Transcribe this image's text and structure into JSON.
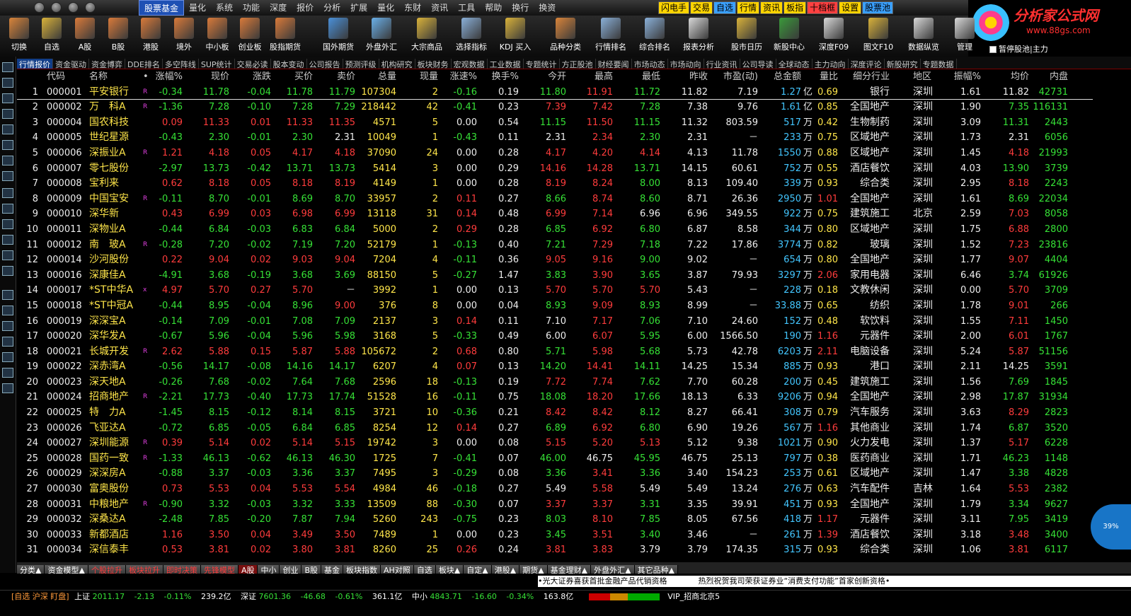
{
  "menu": [
    "股票基金",
    "量化",
    "系统",
    "功能",
    "深度",
    "报价",
    "分析",
    "扩展",
    "量化",
    "东财",
    "资讯",
    "工具",
    "帮助",
    "换行",
    "换资"
  ],
  "quick": [
    "闪电手",
    "交易",
    "自选",
    "行情",
    "资讯",
    "板指",
    "十档框",
    "设置",
    "股票池"
  ],
  "quick_colors": [
    "#ffd400",
    "#ffd400",
    "#3aa0ff",
    "#ffd400",
    "#ffd400",
    "#ffd400",
    "#ff4040",
    "#ffd400",
    "#3aa0ff"
  ],
  "logo": {
    "title": "分析家公式网",
    "url": "www.88gs.com"
  },
  "toolbar": [
    "切换",
    "自选",
    "A股",
    "B股",
    "港股",
    "境外",
    "中小板",
    "创业板",
    "股指期货",
    "国外期货",
    "外盘外汇",
    "大宗商品",
    "选择指标",
    "KDJ 买入",
    "品种分类",
    "行情排名",
    "综合排名",
    "报表分析",
    "股市日历",
    "新股中心",
    "深度F09",
    "图文F10",
    "数据纵览",
    "管理"
  ],
  "toolbar_colors": [
    "#d9843a",
    "#d9b23a",
    "#d97a3a",
    "#d97a3a",
    "#d97a3a",
    "#d97a3a",
    "#d97a3a",
    "#d97a3a",
    "#d97a3a",
    "#4a90d9",
    "#6ab0e9",
    "#d9b23a",
    "#8ab0d9",
    "#d9b23a",
    "#d9843a",
    "#8ab0d9",
    "#8ab0d9",
    "#d9d9d9",
    "#d9b23a",
    "#3a9a3a",
    "#d9d9d9",
    "#d9b23a",
    "#d9d9d9",
    "#d9d9d9"
  ],
  "pause_label": "暂停股池|主力",
  "tabs": [
    "行情报价",
    "资金驱动",
    "资金博弈",
    "DDE排名",
    "多空阵线",
    "SUP统计",
    "交易必读",
    "股本变动",
    "公司报告",
    "预测评级",
    "机构研究",
    "板块财务",
    "宏观数据",
    "工业数据",
    "专题统计",
    "方正股池",
    "财经要闻",
    "市场动态",
    "市场动向",
    "行业资讯",
    "公司导读",
    "全球动态",
    "主力动向",
    "深度评论",
    "新股研究",
    "专题数据"
  ],
  "headers": [
    "",
    "代码",
    "名称",
    "•",
    "涨幅%",
    "现价",
    "涨跌",
    "买价",
    "卖价",
    "总量",
    "现量",
    "涨速%",
    "换手%",
    "今开",
    "最高",
    "最低",
    "昨收",
    "市盈(动)",
    "总金额",
    "量比",
    "细分行业",
    "地区",
    "振幅%",
    "均价",
    "内盘"
  ],
  "rows": [
    [
      "1",
      "000001",
      "平安银行",
      "R",
      "-0.34",
      "11.78",
      "-0.04",
      "11.78",
      "11.79",
      "107304",
      "2",
      "-0.16",
      "0.19",
      "11.80",
      "11.91",
      "11.72",
      "11.82",
      "7.19",
      "1.27",
      "亿",
      "0.69",
      "银行",
      "深圳",
      "1.61",
      "11.82",
      "42731"
    ],
    [
      "2",
      "000002",
      "万　科A",
      "R",
      "-1.36",
      "7.28",
      "-0.10",
      "7.28",
      "7.29",
      "218442",
      "42",
      "-0.41",
      "0.23",
      "7.39",
      "7.42",
      "7.28",
      "7.38",
      "9.76",
      "1.61",
      "亿",
      "0.85",
      "全国地产",
      "深圳",
      "1.90",
      "7.35",
      "116131"
    ],
    [
      "3",
      "000004",
      "国农科技",
      "",
      "0.09",
      "11.33",
      "0.01",
      "11.33",
      "11.35",
      "4571",
      "5",
      "0.00",
      "0.54",
      "11.15",
      "11.50",
      "11.15",
      "11.32",
      "803.59",
      "517",
      "万",
      "0.42",
      "生物制药",
      "深圳",
      "3.09",
      "11.31",
      "2443"
    ],
    [
      "4",
      "000005",
      "世纪星源",
      "",
      "-0.43",
      "2.30",
      "-0.01",
      "2.30",
      "2.31",
      "10049",
      "1",
      "-0.43",
      "0.11",
      "2.31",
      "2.34",
      "2.30",
      "2.31",
      "－",
      "233",
      "万",
      "0.75",
      "区域地产",
      "深圳",
      "1.73",
      "2.31",
      "6056"
    ],
    [
      "5",
      "000006",
      "深振业A",
      "R",
      "1.21",
      "4.18",
      "0.05",
      "4.17",
      "4.18",
      "37090",
      "24",
      "0.00",
      "0.28",
      "4.17",
      "4.20",
      "4.14",
      "4.13",
      "11.78",
      "1550",
      "万",
      "0.88",
      "区域地产",
      "深圳",
      "1.45",
      "4.18",
      "21993"
    ],
    [
      "6",
      "000007",
      "零七股份",
      "",
      "-2.97",
      "13.73",
      "-0.42",
      "13.71",
      "13.73",
      "5414",
      "3",
      "0.00",
      "0.29",
      "14.16",
      "14.28",
      "13.71",
      "14.15",
      "60.61",
      "752",
      "万",
      "0.55",
      "酒店餐饮",
      "深圳",
      "4.03",
      "13.90",
      "3739"
    ],
    [
      "7",
      "000008",
      "宝利来",
      "",
      "0.62",
      "8.18",
      "0.05",
      "8.18",
      "8.19",
      "4149",
      "1",
      "0.00",
      "0.28",
      "8.19",
      "8.24",
      "8.00",
      "8.13",
      "109.40",
      "339",
      "万",
      "0.93",
      "综合类",
      "深圳",
      "2.95",
      "8.18",
      "2243"
    ],
    [
      "8",
      "000009",
      "中国宝安",
      "R",
      "-0.11",
      "8.70",
      "-0.01",
      "8.69",
      "8.70",
      "33957",
      "2",
      "0.11",
      "0.27",
      "8.66",
      "8.74",
      "8.60",
      "8.71",
      "26.36",
      "2950",
      "万",
      "1.01",
      "全国地产",
      "深圳",
      "1.61",
      "8.69",
      "22034"
    ],
    [
      "9",
      "000010",
      "深华新",
      "",
      "0.43",
      "6.99",
      "0.03",
      "6.98",
      "6.99",
      "13118",
      "31",
      "0.14",
      "0.48",
      "6.99",
      "7.14",
      "6.96",
      "6.96",
      "349.55",
      "922",
      "万",
      "0.75",
      "建筑施工",
      "北京",
      "2.59",
      "7.03",
      "8058"
    ],
    [
      "10",
      "000011",
      "深物业A",
      "",
      "-0.44",
      "6.84",
      "-0.03",
      "6.83",
      "6.84",
      "5000",
      "2",
      "0.29",
      "0.28",
      "6.85",
      "6.92",
      "6.80",
      "6.87",
      "8.58",
      "344",
      "万",
      "0.80",
      "区域地产",
      "深圳",
      "1.75",
      "6.88",
      "2800"
    ],
    [
      "11",
      "000012",
      "南　玻A",
      "R",
      "-0.28",
      "7.20",
      "-0.02",
      "7.19",
      "7.20",
      "52179",
      "1",
      "-0.13",
      "0.40",
      "7.21",
      "7.29",
      "7.18",
      "7.22",
      "17.86",
      "3774",
      "万",
      "0.82",
      "玻璃",
      "深圳",
      "1.52",
      "7.23",
      "23816"
    ],
    [
      "12",
      "000014",
      "沙河股份",
      "",
      "0.22",
      "9.04",
      "0.02",
      "9.03",
      "9.04",
      "7204",
      "4",
      "-0.11",
      "0.36",
      "9.05",
      "9.16",
      "9.00",
      "9.02",
      "－",
      "654",
      "万",
      "0.80",
      "全国地产",
      "深圳",
      "1.77",
      "9.07",
      "4404"
    ],
    [
      "13",
      "000016",
      "深康佳A",
      "",
      "-4.91",
      "3.68",
      "-0.19",
      "3.68",
      "3.69",
      "88150",
      "5",
      "-0.27",
      "1.47",
      "3.83",
      "3.90",
      "3.65",
      "3.87",
      "79.93",
      "3297",
      "万",
      "2.06",
      "家用电器",
      "深圳",
      "6.46",
      "3.74",
      "61926"
    ],
    [
      "14",
      "000017",
      "*ST中华A",
      "x",
      "4.97",
      "5.70",
      "0.27",
      "5.70",
      "－",
      "3992",
      "1",
      "0.00",
      "0.13",
      "5.70",
      "5.70",
      "5.70",
      "5.43",
      "－",
      "228",
      "万",
      "0.18",
      "文教休闲",
      "深圳",
      "0.00",
      "5.70",
      "3709"
    ],
    [
      "15",
      "000018",
      "*ST中冠A",
      "",
      "-0.44",
      "8.95",
      "-0.04",
      "8.96",
      "9.00",
      "376",
      "8",
      "0.00",
      "0.04",
      "8.93",
      "9.09",
      "8.93",
      "8.99",
      "－",
      "33.88",
      "万",
      "0.65",
      "纺织",
      "深圳",
      "1.78",
      "9.01",
      "266"
    ],
    [
      "16",
      "000019",
      "深深宝A",
      "",
      "-0.14",
      "7.09",
      "-0.01",
      "7.08",
      "7.09",
      "2137",
      "3",
      "0.14",
      "0.11",
      "7.10",
      "7.17",
      "7.06",
      "7.10",
      "24.60",
      "152",
      "万",
      "0.48",
      "软饮料",
      "深圳",
      "1.55",
      "7.11",
      "1450"
    ],
    [
      "17",
      "000020",
      "深华发A",
      "",
      "-0.67",
      "5.96",
      "-0.04",
      "5.96",
      "5.98",
      "3168",
      "5",
      "-0.33",
      "0.49",
      "6.00",
      "6.07",
      "5.95",
      "6.00",
      "1566.50",
      "190",
      "万",
      "1.16",
      "元器件",
      "深圳",
      "2.00",
      "6.01",
      "1767"
    ],
    [
      "18",
      "000021",
      "长城开发",
      "R",
      "2.62",
      "5.88",
      "0.15",
      "5.87",
      "5.88",
      "105672",
      "2",
      "0.68",
      "0.80",
      "5.71",
      "5.98",
      "5.68",
      "5.73",
      "42.78",
      "6203",
      "万",
      "2.11",
      "电脑设备",
      "深圳",
      "5.24",
      "5.87",
      "51156"
    ],
    [
      "19",
      "000022",
      "深赤湾A",
      "",
      "-0.56",
      "14.17",
      "-0.08",
      "14.16",
      "14.17",
      "6207",
      "4",
      "0.07",
      "0.13",
      "14.20",
      "14.41",
      "14.11",
      "14.25",
      "15.34",
      "885",
      "万",
      "0.93",
      "港口",
      "深圳",
      "2.11",
      "14.25",
      "3591"
    ],
    [
      "20",
      "000023",
      "深天地A",
      "",
      "-0.26",
      "7.68",
      "-0.02",
      "7.64",
      "7.68",
      "2596",
      "18",
      "-0.13",
      "0.19",
      "7.72",
      "7.74",
      "7.62",
      "7.70",
      "60.28",
      "200",
      "万",
      "0.45",
      "建筑施工",
      "深圳",
      "1.56",
      "7.69",
      "1845"
    ],
    [
      "21",
      "000024",
      "招商地产",
      "R",
      "-2.21",
      "17.73",
      "-0.40",
      "17.73",
      "17.74",
      "51528",
      "16",
      "-0.11",
      "0.75",
      "18.08",
      "18.20",
      "17.66",
      "18.13",
      "6.33",
      "9206",
      "万",
      "0.94",
      "全国地产",
      "深圳",
      "2.98",
      "17.87",
      "31934"
    ],
    [
      "22",
      "000025",
      "特　力A",
      "",
      "-1.45",
      "8.15",
      "-0.12",
      "8.14",
      "8.15",
      "3721",
      "10",
      "-0.36",
      "0.21",
      "8.42",
      "8.42",
      "8.12",
      "8.27",
      "66.41",
      "308",
      "万",
      "0.79",
      "汽车服务",
      "深圳",
      "3.63",
      "8.29",
      "2823"
    ],
    [
      "23",
      "000026",
      "飞亚达A",
      "",
      "-0.72",
      "6.85",
      "-0.05",
      "6.84",
      "6.85",
      "8254",
      "12",
      "0.14",
      "0.27",
      "6.89",
      "6.92",
      "6.80",
      "6.90",
      "19.26",
      "567",
      "万",
      "1.16",
      "其他商业",
      "深圳",
      "1.74",
      "6.87",
      "3520"
    ],
    [
      "24",
      "000027",
      "深圳能源",
      "R",
      "0.39",
      "5.14",
      "0.02",
      "5.14",
      "5.15",
      "19742",
      "3",
      "0.00",
      "0.08",
      "5.15",
      "5.20",
      "5.13",
      "5.12",
      "9.38",
      "1021",
      "万",
      "0.90",
      "火力发电",
      "深圳",
      "1.37",
      "5.17",
      "6228"
    ],
    [
      "25",
      "000028",
      "国药一致",
      "R",
      "-1.33",
      "46.13",
      "-0.62",
      "46.13",
      "46.30",
      "1725",
      "7",
      "-0.41",
      "0.07",
      "46.00",
      "46.75",
      "45.95",
      "46.75",
      "25.13",
      "797",
      "万",
      "0.38",
      "医药商业",
      "深圳",
      "1.71",
      "46.23",
      "1148"
    ],
    [
      "26",
      "000029",
      "深深房A",
      "",
      "-0.88",
      "3.37",
      "-0.03",
      "3.36",
      "3.37",
      "7495",
      "3",
      "-0.29",
      "0.08",
      "3.36",
      "3.41",
      "3.36",
      "3.40",
      "154.23",
      "253",
      "万",
      "0.61",
      "区域地产",
      "深圳",
      "1.47",
      "3.38",
      "4828"
    ],
    [
      "27",
      "000030",
      "富奥股份",
      "",
      "0.73",
      "5.53",
      "0.04",
      "5.53",
      "5.54",
      "4984",
      "46",
      "-0.18",
      "0.27",
      "5.49",
      "5.58",
      "5.49",
      "5.49",
      "13.24",
      "276",
      "万",
      "0.63",
      "汽车配件",
      "吉林",
      "1.64",
      "5.53",
      "2382"
    ],
    [
      "28",
      "000031",
      "中粮地产",
      "R",
      "-0.90",
      "3.32",
      "-0.03",
      "3.32",
      "3.33",
      "13509",
      "88",
      "-0.30",
      "0.07",
      "3.37",
      "3.37",
      "3.31",
      "3.35",
      "39.91",
      "451",
      "万",
      "0.93",
      "全国地产",
      "深圳",
      "1.79",
      "3.34",
      "9627"
    ],
    [
      "29",
      "000032",
      "深桑达A",
      "",
      "-2.48",
      "7.85",
      "-0.20",
      "7.87",
      "7.94",
      "5260",
      "243",
      "-0.75",
      "0.23",
      "8.03",
      "8.10",
      "7.85",
      "8.05",
      "67.56",
      "418",
      "万",
      "1.17",
      "元器件",
      "深圳",
      "3.11",
      "7.95",
      "3419"
    ],
    [
      "30",
      "000033",
      "新都酒店",
      "",
      "1.16",
      "3.50",
      "0.04",
      "3.49",
      "3.50",
      "7489",
      "1",
      "0.00",
      "0.23",
      "3.45",
      "3.51",
      "3.40",
      "3.46",
      "－",
      "261",
      "万",
      "1.39",
      "酒店餐饮",
      "深圳",
      "3.18",
      "3.48",
      "3400"
    ],
    [
      "31",
      "000034",
      "深信泰丰",
      "",
      "0.53",
      "3.81",
      "0.02",
      "3.80",
      "3.81",
      "8260",
      "25",
      "0.26",
      "0.24",
      "3.81",
      "3.83",
      "3.79",
      "3.79",
      "174.35",
      "315",
      "万",
      "0.93",
      "综合类",
      "深圳",
      "1.06",
      "3.81",
      "6117"
    ]
  ],
  "bottom_tabs": [
    "分类▲",
    "资金模型▲",
    "个股拉升",
    "板块拉升",
    "即时决策",
    "先锋模型",
    "A股",
    "中小",
    "创业",
    "B股",
    "基金",
    "板块指数",
    "AH对照",
    "自选",
    "板块▲",
    "自定▲",
    "港股▲",
    "期货▲",
    "基金理财▲",
    "外盘外汇▲",
    "其它品种▲"
  ],
  "ticker": "•光大证券喜获首批金融产品代销资格　　　　热烈祝贺我司荣获证券业“消费支付功能”首家创新资格•",
  "status": {
    "prefix": "[自选 沪深 盯盘]",
    "sh_label": "上证",
    "sh_index": "2011.17",
    "sh_change": "-2.13",
    "sh_pct": "-0.11%",
    "sh_amount": "239.2亿",
    "sz_label": "深证",
    "sz_index": "7601.36",
    "sz_change": "-46.68",
    "sz_pct": "-0.61%",
    "sz_amount": "361.1亿",
    "zx_label": "中小",
    "zx_index": "4843.71",
    "zx_change": "-16.60",
    "zx_pct": "-0.34%",
    "zx_amount": "163.8亿",
    "server": "VIP_招商北京5"
  },
  "bubble": "39%"
}
